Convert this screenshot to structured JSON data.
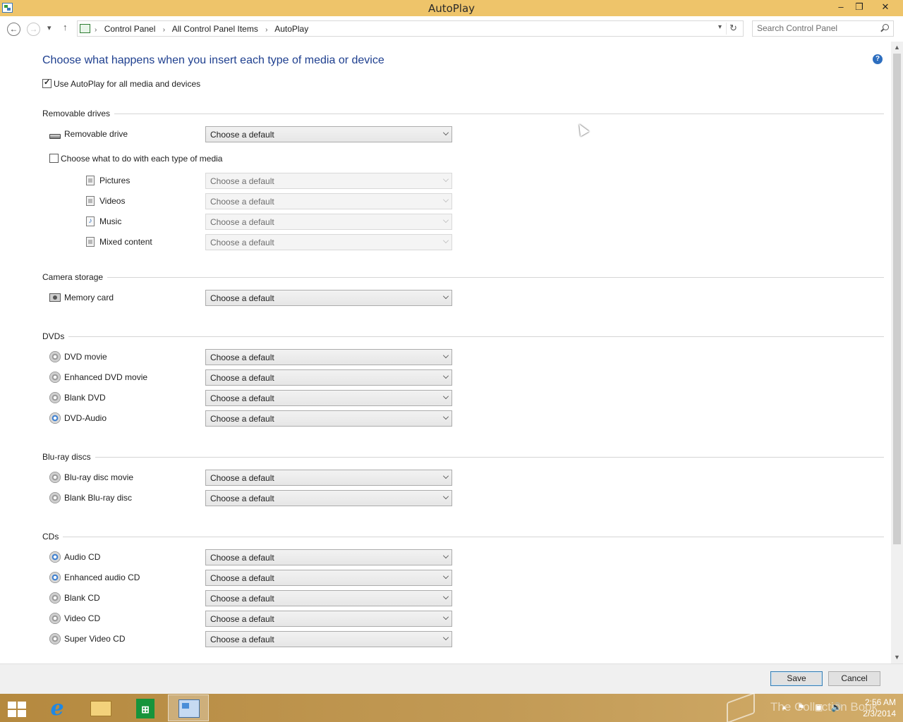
{
  "window": {
    "title": "AutoPlay",
    "minimize_glyph": "‒",
    "restore_glyph": "❐",
    "close_glyph": "✕"
  },
  "nav": {
    "back_glyph": "←",
    "forward_glyph": "→",
    "recent_glyph": "▾",
    "up_glyph": "↑",
    "breadcrumbs": [
      "Control Panel",
      "All Control Panel Items",
      "AutoPlay"
    ],
    "breadcrumb_sep": "›",
    "dropdown_glyph": "▾",
    "refresh_glyph": "↻",
    "search_placeholder": "Search Control Panel"
  },
  "main": {
    "heading": "Choose what happens when you insert each type of media or device",
    "help_glyph": "?",
    "use_autoplay": {
      "label": "Use AutoPlay for all media and devices",
      "checked": true
    },
    "default_option": "Choose a default",
    "sections": {
      "removable": {
        "title": "Removable drives",
        "drive_label": "Removable drive",
        "each_media_label": "Choose what to do with each type of media",
        "each_media_checked": false,
        "media": [
          "Pictures",
          "Videos",
          "Music",
          "Mixed content"
        ]
      },
      "camera": {
        "title": "Camera storage",
        "items": [
          "Memory card"
        ]
      },
      "dvds": {
        "title": "DVDs",
        "items": [
          "DVD movie",
          "Enhanced DVD movie",
          "Blank DVD",
          "DVD-Audio"
        ]
      },
      "bluray": {
        "title": "Blu-ray discs",
        "items": [
          "Blu-ray disc movie",
          "Blank Blu-ray disc"
        ]
      },
      "cds": {
        "title": "CDs",
        "items": [
          "Audio CD",
          "Enhanced audio CD",
          "Blank CD",
          "Video CD",
          "Super Video CD"
        ]
      }
    }
  },
  "footer": {
    "save_label": "Save",
    "cancel_label": "Cancel"
  },
  "taskbar": {
    "ie_glyph": "e",
    "tray_glyphs": [
      "▲",
      "⚑",
      "▣",
      "🔊"
    ],
    "time": "2:56 AM",
    "date": "2/3/2014",
    "watermark": "The Collection Book"
  },
  "scrollbar": {
    "up_glyph": "▲",
    "down_glyph": "▼"
  },
  "colors": {
    "titlebar": "#eec46a",
    "heading": "#1e3f8f",
    "taskbar": "#c29a55",
    "help": "#2d6ebf"
  }
}
